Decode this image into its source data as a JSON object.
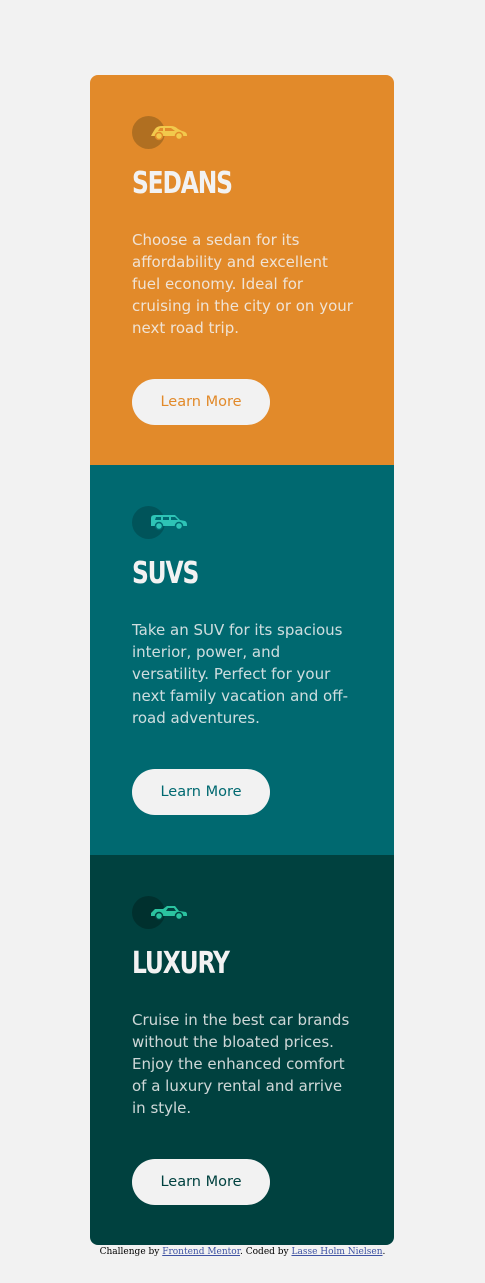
{
  "cards": [
    {
      "title": "SEDANS",
      "description": "Choose a sedan for its affordability and excellent fuel economy. Ideal for cruising in the city or on your next road trip.",
      "button_label": "Learn More",
      "icon": "sedan-car-icon",
      "accent_color": "#e28a2a",
      "icon_color": "#f2c94c"
    },
    {
      "title": "SUVS",
      "description": "Take an SUV for its spacious interior, power, and versatility. Perfect for your next family vacation and off-road adventures.",
      "button_label": "Learn More",
      "icon": "suv-car-icon",
      "accent_color": "#006970",
      "icon_color": "#2ec4b6"
    },
    {
      "title": "LUXURY",
      "description": "Cruise in the best car brands without the bloated prices. Enjoy the enhanced comfort of a luxury rental and arrive in style.",
      "button_label": "Learn More",
      "icon": "luxury-car-icon",
      "accent_color": "#00413f",
      "icon_color": "#2bc3a0"
    }
  ],
  "attribution": {
    "prefix": "Challenge by ",
    "link1": "Frontend Mentor",
    "middle": ". Coded by ",
    "link2": "Lasse Holm Nielsen",
    "suffix": "."
  }
}
